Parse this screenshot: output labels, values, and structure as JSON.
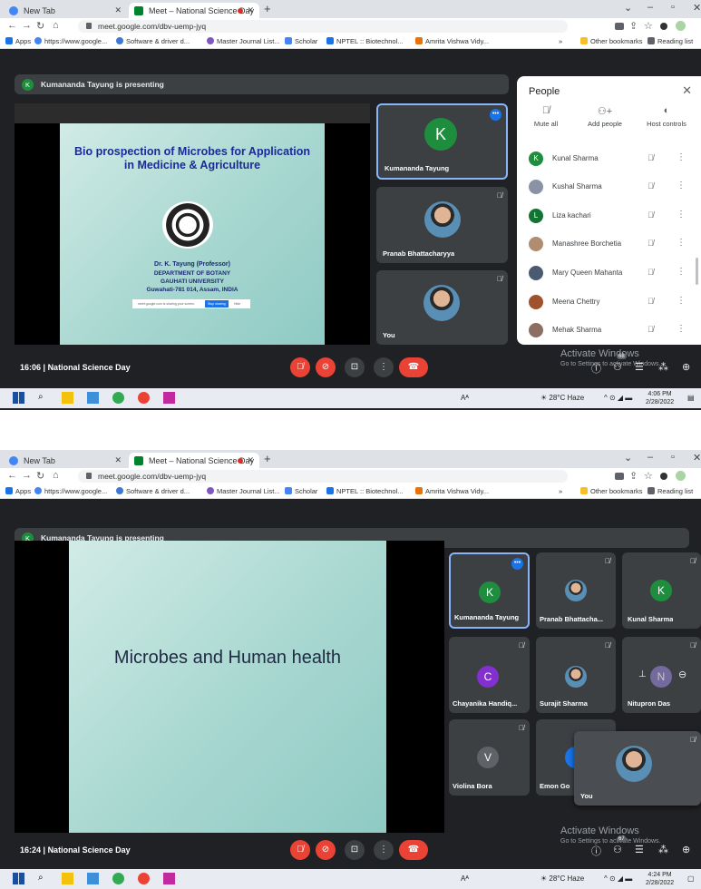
{
  "browser": {
    "tabs": [
      {
        "label": "New Tab"
      },
      {
        "label": "Meet – National Science Day"
      }
    ],
    "new_tab_symbol": "+",
    "url": "meet.google.com/dbv-uemp-jyq",
    "bookmarks": [
      {
        "label": "Apps"
      },
      {
        "label": "https://www.google..."
      },
      {
        "label": "Software & driver d..."
      },
      {
        "label": "Master Journal List..."
      },
      {
        "label": "Scholar"
      },
      {
        "label": "NPTEL :: Biotechnol..."
      },
      {
        "label": "Amrita Vishwa Vidy..."
      }
    ],
    "bookmarks_overflow": "»",
    "other_bookmarks": "Other bookmarks",
    "reading_list": "Reading list"
  },
  "screen1": {
    "presenting_banner": "Kumananda Tayung is presenting",
    "presenter_initial": "K",
    "slide": {
      "title": "Bio prospection of Microbes for Application in Medicine & Agriculture",
      "author": "Dr. K. Tayung (Professor)",
      "dept": "DEPARTMENT OF BOTANY",
      "univ": "GAUHATI UNIVERSITY",
      "addr": "Guwahati-781 014, Assam, INDIA",
      "share_notice": "meet.google.com is sharing your screen.",
      "stop_sharing": "Stop sharing",
      "hide": "Hide"
    },
    "tiles": [
      {
        "name": "Kumananda Tayung",
        "initial": "K"
      },
      {
        "name": "Pranab Bhattacharyya"
      },
      {
        "name": "You"
      }
    ],
    "meeting_time": "16:06",
    "meeting_title": "National Science Day",
    "people_panel": {
      "title": "People",
      "mute_all": "Mute all",
      "add_people": "Add people",
      "host_controls": "Host controls",
      "participants": [
        {
          "name": "Kunal Sharma",
          "initial": "K",
          "color": "#1e8e3e"
        },
        {
          "name": "Kushal Sharma",
          "initial": "",
          "color": "#8a93a3"
        },
        {
          "name": "Liza kachari",
          "initial": "L",
          "color": "#137333"
        },
        {
          "name": "Manashree Borchetia",
          "initial": "",
          "color": "#b08d70"
        },
        {
          "name": "Mary Queen Mahanta",
          "initial": "",
          "color": "#4a5a70"
        },
        {
          "name": "Meena Chettry",
          "initial": "",
          "color": "#a0522d"
        },
        {
          "name": "Mehak Sharma",
          "initial": "",
          "color": "#8d6e63"
        }
      ]
    },
    "activate_title": "Activate Windows",
    "activate_sub": "Go to Settings to activate Windows.",
    "people_count": "68",
    "weather": "28°C Haze",
    "clock_time": "4:06 PM",
    "clock_date": "2/28/2022"
  },
  "screen2": {
    "presenting_banner": "Kumananda Tayung is presenting",
    "presenter_initial": "K",
    "slide_title": "Microbes and Human health",
    "tiles": [
      {
        "name": "Kumananda Tayung",
        "initial": "K",
        "color": "#1e8e3e"
      },
      {
        "name": "Pranab Bhattacha..."
      },
      {
        "name": "Kunal Sharma",
        "initial": "K",
        "color": "#1e8e3e"
      },
      {
        "name": "Chayanika Handiq...",
        "initial": "C",
        "color": "#8430ce"
      },
      {
        "name": "Surajit Sharma"
      },
      {
        "name": "Nitupron Das",
        "initial": "N",
        "color": "#8e7cc3"
      },
      {
        "name": "Violina Bora",
        "initial": "V",
        "color": "#5f6368"
      },
      {
        "name": "Emon Go"
      }
    ],
    "self_tile": "You",
    "meeting_time": "16:24",
    "meeting_title": "National Science Day",
    "activate_title": "Activate Windows",
    "activate_sub": "Go to Settings to activate Windows.",
    "people_count": "67",
    "weather": "28°C Haze",
    "clock_time": "4:24 PM",
    "clock_date": "2/28/2022"
  }
}
